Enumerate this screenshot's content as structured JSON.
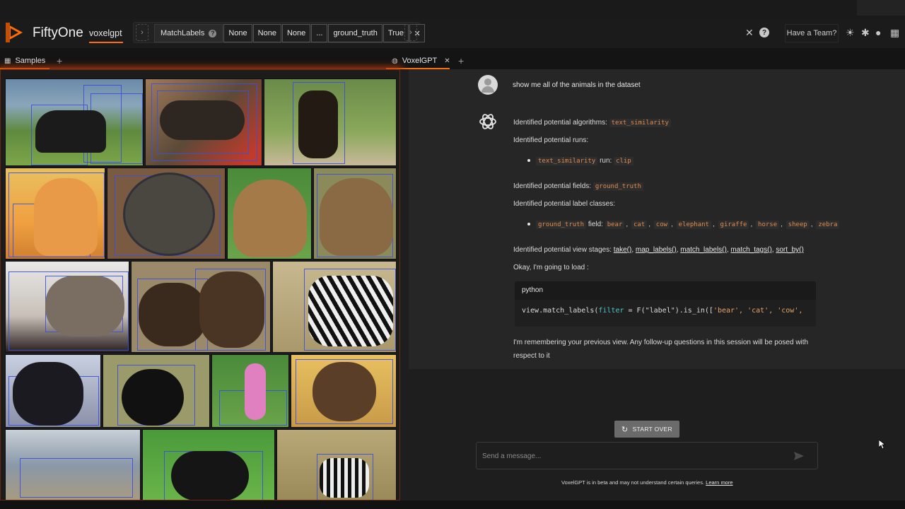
{
  "app": {
    "brand": "FiftyOne",
    "dataset": "voxelgpt",
    "accent": "#ff6d04"
  },
  "viewbar": {
    "stage_name": "MatchLabels",
    "params": [
      "None",
      "None",
      "None",
      "...",
      "ground_truth",
      "True"
    ],
    "remove_icon": "close-icon"
  },
  "header_right": {
    "team_label": "Have a Team?"
  },
  "tabs": {
    "left": "Samples",
    "right": "VoxelGPT"
  },
  "chat": {
    "user_message": "show me all of the animals in the dataset",
    "algorithms_label": "Identified potential algorithms:",
    "algorithms_value": "text_similarity",
    "runs_label": "Identified potential runs:",
    "run_key": "text_similarity",
    "run_mid": "run:",
    "run_value": "clip",
    "fields_label": "Identified potential fields:",
    "fields_value": "ground_truth",
    "classes_label": "Identified potential label classes:",
    "classes_field": "ground_truth",
    "classes_mid": "field:",
    "classes": [
      "bear",
      "cat",
      "cow",
      "elephant",
      "giraffe",
      "horse",
      "sheep",
      "zebra"
    ],
    "stages_label": "Identified potential view stages:",
    "stages": [
      "take()",
      "map_labels()",
      "match_labels()",
      "match_tags()",
      "sort_by()"
    ],
    "loading": "Okay, I'm going to load :",
    "code_lang": "python",
    "code_pre": "view.match_labels(",
    "code_kw": "filter",
    "code_mid": " = F(\"label\").is_in([",
    "code_strs": "'bear', 'cat', 'cow',",
    "remember_1": "I'm remembering your previous view. Any follow-up questions in this session will be posed with",
    "remember_2": "respect to it"
  },
  "footer": {
    "start_over": "START OVER",
    "input_placeholder": "Send a message...",
    "disclaimer": "VoxelGPT is in beta and may not understand certain queries.",
    "learn_more": "Learn more"
  }
}
